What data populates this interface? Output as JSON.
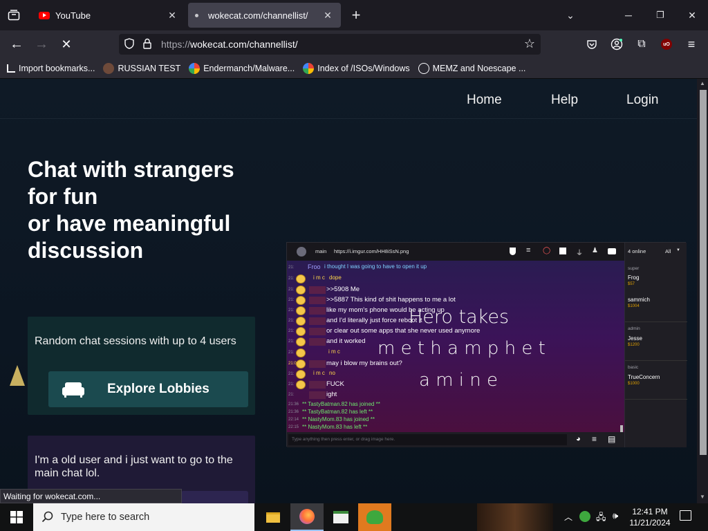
{
  "browser": {
    "tabs": [
      {
        "label": "YouTube",
        "active": false
      },
      {
        "label": "wokecat.com/channellist/",
        "active": true
      }
    ],
    "url": {
      "protocol": "https://",
      "host_path": "wokecat.com/channellist/"
    },
    "bookmarks": [
      {
        "label": "Import bookmarks...",
        "icon": "import-icon"
      },
      {
        "label": "RUSSIAN TEST",
        "icon": "github-icon"
      },
      {
        "label": "Endermanch/Malware...",
        "icon": "google-icon"
      },
      {
        "label": "Index of /ISOs/Windows",
        "icon": "google-icon"
      },
      {
        "label": "MEMZ and Noescape ...",
        "icon": "globe-icon"
      }
    ],
    "status_text": "Waiting for wokecat.com...",
    "colors": {
      "chrome": "#1c1b22",
      "toolbar": "#2b2a33",
      "youtube_red": "#ff0000",
      "ublock_red": "#800000"
    }
  },
  "site": {
    "nav": [
      "Home",
      "Help",
      "Login"
    ],
    "hero_lines": [
      "Chat with strangers",
      "for fun",
      "or have meaningful",
      "discussion"
    ],
    "card1": {
      "description": "Random chat sessions with up to 4 users",
      "button_label": "Explore Lobbies"
    },
    "card2": {
      "description": "I'm a old user and i just want to go to the main chat lol."
    },
    "colors": {
      "background": "#0c1622",
      "card1": "#102a2e",
      "button": "#1b4a4f",
      "card2": "#1f1a36"
    }
  },
  "preview": {
    "top_bar": {
      "channel": "main",
      "link": "https://i.imgur.com/HH8iSsN.png",
      "online": "4 online",
      "filter": "All"
    },
    "messages": [
      {
        "time": "21:",
        "name": "Froo",
        "text": "i thought I was going to have to open it up"
      },
      {
        "time": "21:",
        "name": "i m c",
        "text": "dope"
      },
      {
        "time": "21:",
        "name": "",
        "text": ">>5908 Me"
      },
      {
        "time": "21:",
        "name": "",
        "text": ">>5887 This kind of shit happens to me a lot"
      },
      {
        "time": "21:",
        "name": "",
        "text": "like my mom's phone would be acting up"
      },
      {
        "time": "21:",
        "name": "",
        "text": "and I'd literally just force reboot it"
      },
      {
        "time": "21:",
        "name": "",
        "text": "or clear out some apps that she never used anymore"
      },
      {
        "time": "21:",
        "name": "",
        "text": "and it worked"
      },
      {
        "time": "21:",
        "name": "i m c",
        "text": ""
      },
      {
        "time": "21:04",
        "name": "",
        "text": "may i blow my brains out?"
      },
      {
        "time": "21:",
        "name": "i m c",
        "text": "no"
      },
      {
        "time": "21:",
        "name": "",
        "text": "FUCK"
      },
      {
        "time": "21:",
        "name": "",
        "text": "ight"
      }
    ],
    "system": [
      {
        "time": "21:36",
        "text": "** TastyBatman.82 has joined **"
      },
      {
        "time": "21:36",
        "text": "** TastyBatman.82 has left **"
      },
      {
        "time": "22:14",
        "text": "** NastyMom.83 has joined **"
      },
      {
        "time": "22:15",
        "text": "** NastyMom.83 has left **"
      }
    ],
    "overlay": [
      "Hero takes",
      "m e t h a m p h e t",
      "a m i n e"
    ],
    "input_placeholder": "Type anything then press enter, or drag image here.",
    "sidebar": [
      {
        "section": "super",
        "user": "Frog",
        "cash": "$57"
      },
      {
        "section": "",
        "user": "sammich",
        "cash": "$1004"
      },
      {
        "section": "admin",
        "user": "Jesse",
        "cash": "$1200"
      },
      {
        "section": "basic",
        "user": "TrueConcern",
        "cash": "$1000"
      }
    ]
  },
  "taskbar": {
    "search_placeholder": "Type here to search",
    "time": "12:41 PM",
    "date": "11/21/2024"
  }
}
